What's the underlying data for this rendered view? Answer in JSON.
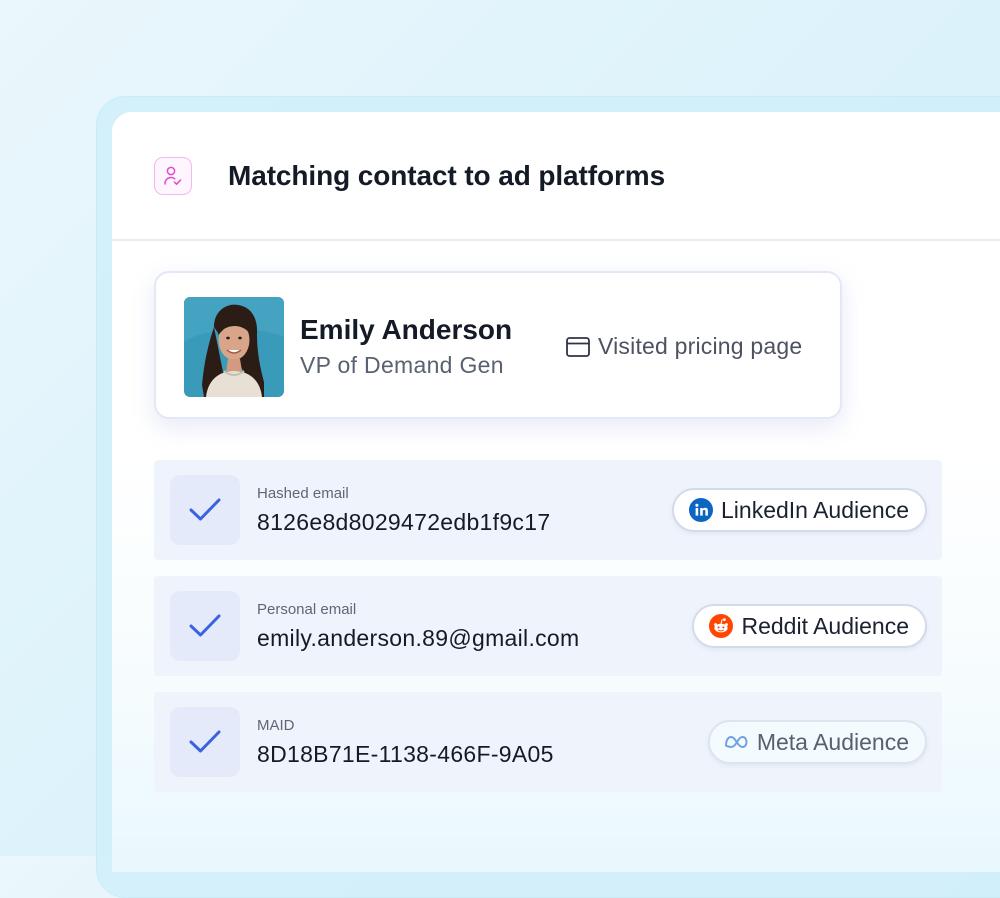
{
  "header": {
    "title": "Matching contact to ad platforms",
    "icon": "user-check-icon"
  },
  "contact": {
    "name": "Emily Anderson",
    "role": "VP of Demand Gen",
    "activity": "Visited pricing page",
    "activity_icon": "browser-window-icon"
  },
  "matches": [
    {
      "label": "Hashed email",
      "value": "8126e8d8029472edb1f9c17",
      "platform": "LinkedIn Audience",
      "platform_icon": "linkedin-icon",
      "brand_color": "#0a66c2",
      "status": "matched"
    },
    {
      "label": "Personal email",
      "value": "emily.anderson.89@gmail.com",
      "platform": "Reddit Audience",
      "platform_icon": "reddit-icon",
      "brand_color": "#ff4500",
      "status": "matched"
    },
    {
      "label": "MAID",
      "value": "8D18B71E-1138-466F-9A05",
      "platform": "Meta Audience",
      "platform_icon": "meta-icon",
      "brand_color": "#6fa3e0",
      "status": "matched"
    }
  ],
  "colors": {
    "check": "#3b63e0",
    "accent_pink": "#e14bd2"
  }
}
